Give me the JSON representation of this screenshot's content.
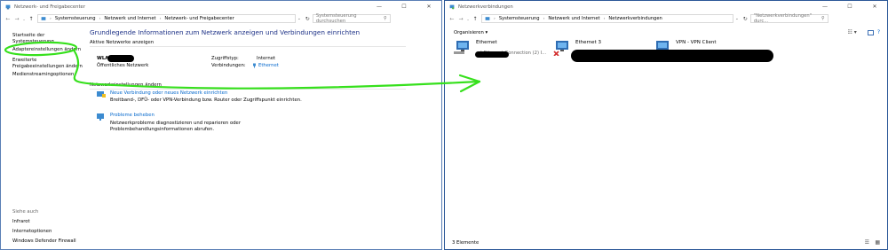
{
  "left_window": {
    "title": "Netzwerk- und Freigabecenter",
    "breadcrumbs": [
      "Systemsteuerung",
      "Netzwerk und Internet",
      "Netzwerk- und Freigabecenter"
    ],
    "search_placeholder": "Systemsteuerung durchsuchen",
    "sidebar": {
      "items": [
        {
          "label": "Startseite der Systemsteuerung"
        },
        {
          "label": "Adaptereinstellungen ändern"
        },
        {
          "label": "Erweiterte Freigabeeinstellungen ändern"
        },
        {
          "label": "Medienstreamingoptionen"
        }
      ],
      "see_also_heading": "Siehe auch",
      "see_also": [
        {
          "label": "Infrarot"
        },
        {
          "label": "Internetoptionen"
        },
        {
          "label": "Windows Defender Firewall"
        }
      ]
    },
    "main": {
      "heading": "Grundlegende Informationen zum Netzwerk anzeigen und Verbindungen einrichten",
      "active_networks_heading": "Aktive Netzwerke anzeigen",
      "network_name": "WLA",
      "network_type": "Öffentliches Netzwerk",
      "access_type_label": "Zugriffstyp:",
      "access_type_value": "Internet",
      "connections_label": "Verbindungen:",
      "connections_value": "Ethernet",
      "change_settings_heading": "Netzwerkeinstellungen ändern",
      "tasks": [
        {
          "title": "Neue Verbindung oder neues Netzwerk einrichten",
          "desc": "Breitband-, DFÜ- oder VPN-Verbindung bzw. Router oder Zugriffspunkt einrichten."
        },
        {
          "title": "Probleme beheben",
          "desc": "Netzwerkprobleme diagnostizieren und reparieren oder Problembehandlungsinformationen abrufen."
        }
      ]
    }
  },
  "right_window": {
    "title": "Netzwerkverbindungen",
    "breadcrumbs": [
      "Systemsteuerung",
      "Netzwerk und Internet",
      "Netzwerkverbindungen"
    ],
    "search_placeholder": "\"Netzwerkverbindungen\" durc...",
    "organize_label": "Organisieren",
    "connections": [
      {
        "name": "Ethernet",
        "status": "",
        "device": "...) Ethernet Connection (2) I..."
      },
      {
        "name": "Ethernet 3",
        "status": "",
        "device": ""
      },
      {
        "name": "VPN - VPN Client",
        "status": "",
        "device": ""
      }
    ],
    "status_count": "3 Elemente"
  },
  "colors": {
    "link_blue": "#0066cc",
    "heading_blue": "#1e3287",
    "annotation_green": "#36e01c"
  }
}
